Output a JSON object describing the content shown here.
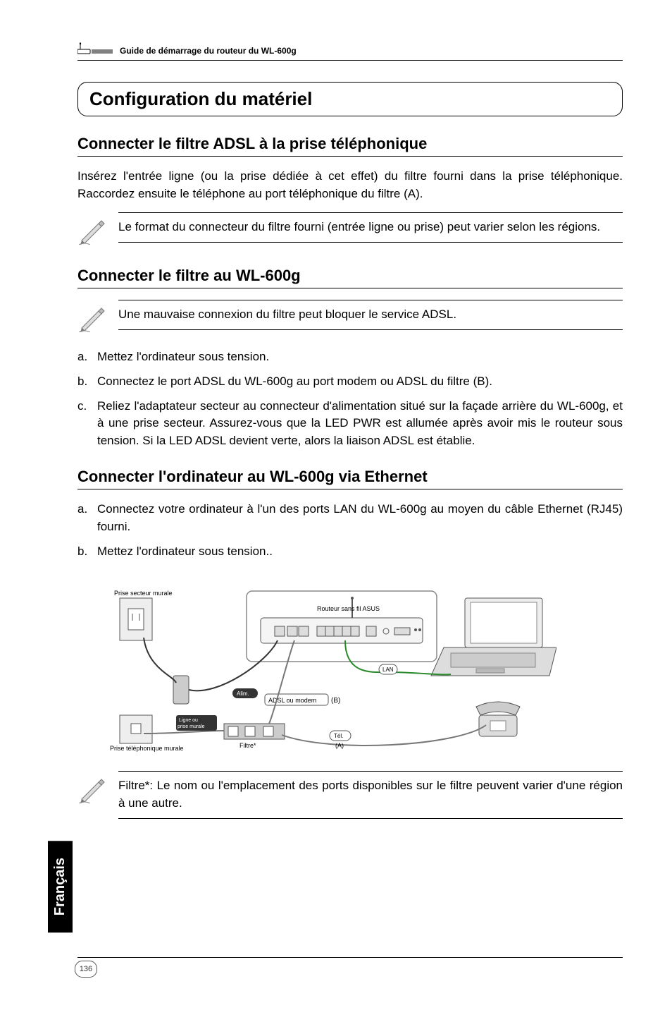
{
  "header": {
    "guide_title": "Guide de démarrage du routeur du WL-600g"
  },
  "main_heading": "Configuration du matériel",
  "section1": {
    "title": "Connecter le filtre ADSL à la prise téléphonique",
    "para": "Insérez l'entrée ligne (ou la prise dédiée à cet effet) du filtre fourni dans la prise téléphonique. Raccordez ensuite le téléphone au port téléphonique du filtre (A).",
    "note": "Le format du connecteur du filtre fourni (entrée ligne ou prise) peut varier selon les régions."
  },
  "section2": {
    "title": "Connecter le filtre au WL-600g",
    "note": "Une mauvaise connexion du filtre peut bloquer le service ADSL.",
    "items": [
      {
        "m": "a.",
        "t": "Mettez l'ordinateur sous tension."
      },
      {
        "m": "b.",
        "t": "Connectez le port ADSL du WL-600g au port modem ou ADSL du filtre (B)."
      },
      {
        "m": "c.",
        "t": "Reliez l'adaptateur secteur au connecteur d'alimentation situé sur la façade arrière du WL-600g, et à une prise secteur. Assurez-vous que la LED PWR est allumée après avoir mis le routeur sous tension. Si la LED ADSL devient verte, alors la liaison ADSL est établie."
      }
    ]
  },
  "section3": {
    "title": "Connecter l'ordinateur au WL-600g via Ethernet",
    "items": [
      {
        "m": "a.",
        "t": "Connectez votre ordinateur à l'un des ports LAN du WL-600g au moyen du câble Ethernet (RJ45) fourni."
      },
      {
        "m": "b.",
        "t": "Mettez l'ordinateur sous tension.."
      }
    ]
  },
  "diagram": {
    "wall_power": "Prise secteur murale",
    "router": "Routeur sans fil ASUS",
    "power": "Alim.",
    "adsl_modem": "ADSL ou modem",
    "b_label": "(B)",
    "line": "Ligne ou\nprise murale",
    "wall_phone": "Prise téléphonique murale",
    "filter": "Filtre*",
    "tel": "Tél.",
    "a_label": "(A)",
    "lan": "LAN"
  },
  "footnote": "Filtre*: Le nom ou l'emplacement des ports disponibles sur le filtre peuvent varier d'une région à une autre.",
  "side_tab": "Français",
  "page_num": "136"
}
